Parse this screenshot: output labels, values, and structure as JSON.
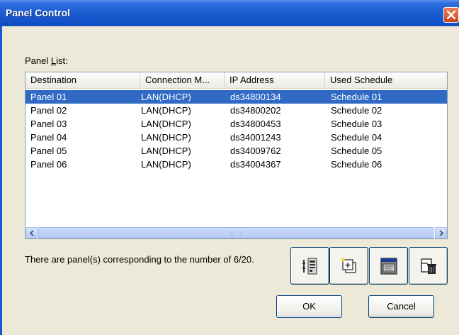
{
  "window": {
    "title": "Panel Control"
  },
  "panel_list": {
    "label_prefix": "Panel ",
    "label_accel": "L",
    "label_suffix": "ist:",
    "columns": [
      "Destination",
      "Connection M...",
      "IP Address",
      "Used Schedule"
    ],
    "rows": [
      {
        "destination": "Panel 01",
        "connection": "LAN(DHCP)",
        "ip": "ds34800134",
        "schedule": "Schedule 01",
        "selected": true
      },
      {
        "destination": "Panel 02",
        "connection": "LAN(DHCP)",
        "ip": "ds34800202",
        "schedule": "Schedule 02",
        "selected": false
      },
      {
        "destination": "Panel 03",
        "connection": "LAN(DHCP)",
        "ip": "ds34800453",
        "schedule": "Schedule 03",
        "selected": false
      },
      {
        "destination": "Panel 04",
        "connection": "LAN(DHCP)",
        "ip": "ds34001243",
        "schedule": "Schedule 04",
        "selected": false
      },
      {
        "destination": "Panel 05",
        "connection": "LAN(DHCP)",
        "ip": "ds34009762",
        "schedule": "Schedule 05",
        "selected": false
      },
      {
        "destination": "Panel 06",
        "connection": "LAN(DHCP)",
        "ip": "ds34004367",
        "schedule": "Schedule 06",
        "selected": false
      }
    ]
  },
  "status": {
    "text": "There are panel(s) corresponding to the number of 6/20."
  },
  "toolbar": {
    "icons": [
      "panel-settings-icon",
      "add-panel-icon",
      "panel-display-icon",
      "delete-panel-icon"
    ]
  },
  "buttons": {
    "ok": "OK",
    "cancel": "Cancel"
  },
  "colors": {
    "selection": "#316ac5",
    "titlebar": "#1f5fd4",
    "dialog_bg": "#ece9d8"
  }
}
